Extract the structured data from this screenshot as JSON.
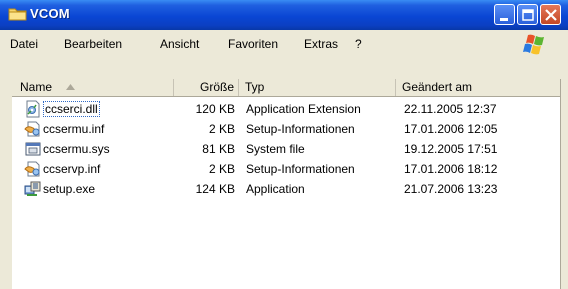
{
  "window": {
    "title": "VCOM"
  },
  "menu": {
    "items": [
      "Datei",
      "Bearbeiten",
      "Ansicht",
      "Favoriten",
      "Extras",
      "?"
    ]
  },
  "columns": [
    "Name",
    "Größe",
    "Typ",
    "Geändert am"
  ],
  "files": [
    {
      "name": "ccserci.dll",
      "size": "120 KB",
      "type": "Application Extension",
      "modified": "22.11.2005 12:37",
      "icon": "dll-file-icon"
    },
    {
      "name": "ccsermu.inf",
      "size": "2 KB",
      "type": "Setup-Informationen",
      "modified": "17.01.2006 12:05",
      "icon": "inf-file-icon"
    },
    {
      "name": "ccsermu.sys",
      "size": "81 KB",
      "type": "System file",
      "modified": "19.12.2005 17:51",
      "icon": "sys-file-icon"
    },
    {
      "name": "ccservp.inf",
      "size": "2 KB",
      "type": "Setup-Informationen",
      "modified": "17.01.2006 18:12",
      "icon": "inf-file-icon"
    },
    {
      "name": "setup.exe",
      "size": "124 KB",
      "type": "Application",
      "modified": "21.07.2006 13:23",
      "icon": "exe-file-icon"
    }
  ],
  "colors": {
    "titlebar": "#0a46d4",
    "chrome": "#ece9d8",
    "selection_border": "#316ac5"
  }
}
